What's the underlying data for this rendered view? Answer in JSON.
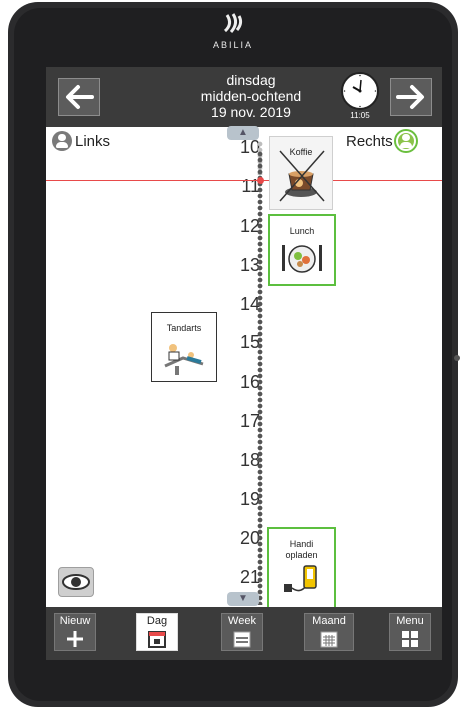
{
  "brand": {
    "name": "ABILIA"
  },
  "header": {
    "weekday": "dinsdag",
    "daypart": "midden-ochtend",
    "date": "19 nov. 2019",
    "clock_time": "11:05",
    "prev_icon": "arrow-left-icon",
    "next_icon": "arrow-right-icon"
  },
  "timeline": {
    "left_label": "Links",
    "right_label": "Rechts",
    "hours": [
      "10",
      "11",
      "12",
      "13",
      "14",
      "15",
      "16",
      "17",
      "18",
      "19",
      "20",
      "21"
    ],
    "current_time_indicator_color": "#e84a4a"
  },
  "activities": {
    "koffie": {
      "title": "Koffie",
      "state": "passed"
    },
    "lunch": {
      "title": "Lunch"
    },
    "tandarts": {
      "title": "Tandarts"
    },
    "handi": {
      "title_line1": "Handi",
      "title_line2": "opladen"
    }
  },
  "toolbar": {
    "nieuw": "Nieuw",
    "dag": "Dag",
    "week": "Week",
    "maand": "Maand",
    "menu": "Menu"
  },
  "colors": {
    "accent_green": "#5cbf3f",
    "header_bg": "#3b3b3b"
  }
}
